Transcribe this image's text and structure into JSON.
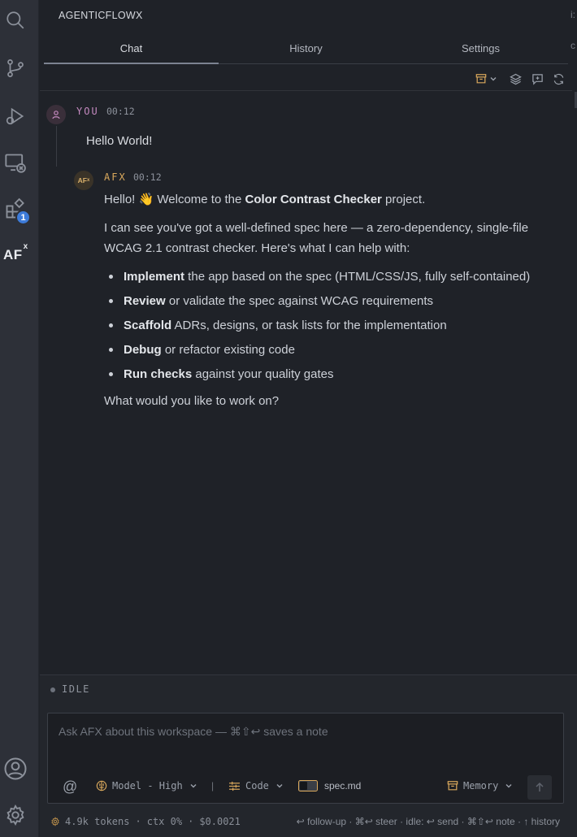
{
  "activity_bar": {
    "extensions_badge": "1",
    "logo_text": "AF",
    "logo_superscript": "x"
  },
  "panel": {
    "title": "AGENTICFLOWX",
    "edge_glyph_top": "i:",
    "edge_glyph_tabs": "c"
  },
  "tabs": [
    {
      "label": "Chat",
      "active": true
    },
    {
      "label": "History",
      "active": false
    },
    {
      "label": "Settings",
      "active": false
    }
  ],
  "messages": {
    "user": {
      "role": "YOU",
      "time": "00:12",
      "text": "Hello World!"
    },
    "afx": {
      "avatar_text": "AF",
      "avatar_superscript": "x",
      "role": "AFX",
      "time": "00:12",
      "intro_before": "Hello! ",
      "wave_emoji": "👋",
      "intro_mid": " Welcome to the ",
      "intro_bold": "Color Contrast Checker",
      "intro_after": " project.",
      "paragraph": "I can see you've got a well-defined spec here — a zero-dependency, single-file WCAG 2.1 contrast checker. Here's what I can help with:",
      "list": [
        {
          "bold": "Implement",
          "rest": " the app based on the spec (HTML/CSS/JS, fully self-contained)"
        },
        {
          "bold": "Review",
          "rest": " or validate the spec against WCAG requirements"
        },
        {
          "bold": "Scaffold",
          "rest": " ADRs, designs, or task lists for the implementation"
        },
        {
          "bold": "Debug",
          "rest": " or refactor existing code"
        },
        {
          "bold": "Run checks",
          "rest": " against your quality gates"
        }
      ],
      "closing": "What would you like to work on?"
    }
  },
  "status": {
    "state": "IDLE"
  },
  "composer": {
    "placeholder": "Ask AFX about this workspace — ⌘⇧↩ saves a note",
    "mention_symbol": "@",
    "model_label": "Model - High",
    "separator": "|",
    "mode_label": "Code",
    "context_file": "spec.md",
    "memory_label": "Memory"
  },
  "footer": {
    "tokens": "4.9k tokens",
    "ctx": "ctx 0%",
    "cost": "$0.0021",
    "dot": "·",
    "hints": "↩ follow-up · ⌘↩ steer · idle: ↩ send · ⌘⇧↩ note · ↑ history"
  },
  "colors": {
    "background": "#1f2228",
    "activity_bar": "#2d3038",
    "user_accent": "#c58ac0",
    "afx_accent": "#d9a85c",
    "badge": "#3d7bd9"
  }
}
